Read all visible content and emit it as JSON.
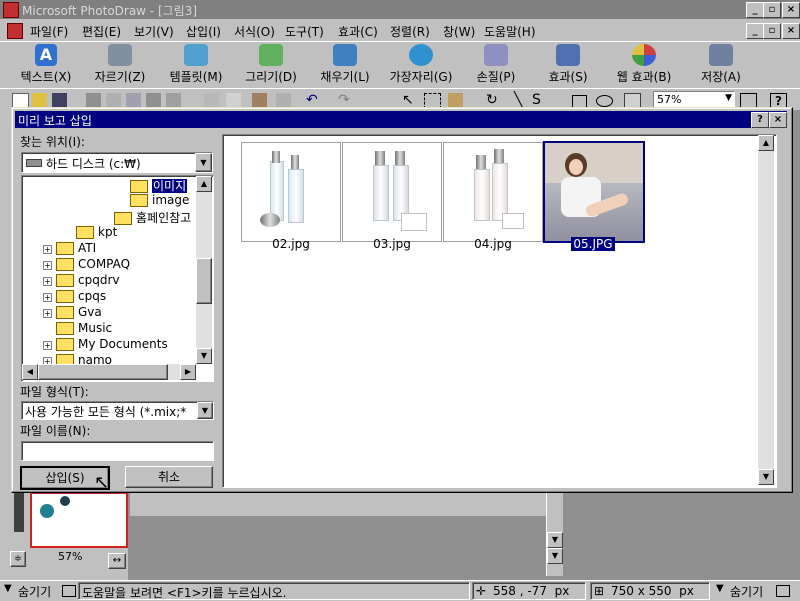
{
  "app": {
    "title": "Microsoft PhotoDraw - [그림3]"
  },
  "menu": [
    "파일(F)",
    "편집(E)",
    "보기(V)",
    "삽입(I)",
    "서식(O)",
    "도구(T)",
    "효과(C)",
    "정렬(R)",
    "창(W)",
    "도움말(H)"
  ],
  "big_toolbar": [
    "텍스트(X)",
    "자르기(Z)",
    "템플릿(M)",
    "그리기(D)",
    "채우기(L)",
    "가장자리(G)",
    "손질(P)",
    "효과(S)",
    "웹 효과(B)",
    "저장(A)"
  ],
  "small_toolbar": {
    "zoom": "57%"
  },
  "dialog": {
    "title": "미리 보고 삽입",
    "help_btn": "?",
    "close_btn": "×",
    "look_in_label": "찾는 위치(I):",
    "look_in_value": "하드 디스크 (c:₩)",
    "tree": [
      "이미지",
      "image",
      "홈페인참고",
      "kpt",
      "ATI",
      "COMPAQ",
      "cpqdrv",
      "cpqs",
      "Gva",
      "Music",
      "My Documents",
      "namo"
    ],
    "file_type_label": "파일 형식(T):",
    "file_type_value": "사용 가능한 모든 형식 (*.mix;*",
    "file_name_label": "파일 이름(N):",
    "file_name_value": "",
    "insert_btn": "삽입(S)",
    "cancel_btn": "취소",
    "files": [
      "02.jpg",
      "03.jpg",
      "04.jpg",
      "05.JPG"
    ]
  },
  "left_panel": {
    "zoom": "57%"
  },
  "status": {
    "hide_left": "숨기기",
    "help_text": "도움말을 보려면 <F1>키를 누르십시오.",
    "coords": "558 , -77  px",
    "size": "750 x 550  px",
    "hide_right": "숨기기"
  },
  "colors": {
    "titlebar_active": "#000080",
    "face": "#c0c0c0",
    "selection": "#000080"
  }
}
